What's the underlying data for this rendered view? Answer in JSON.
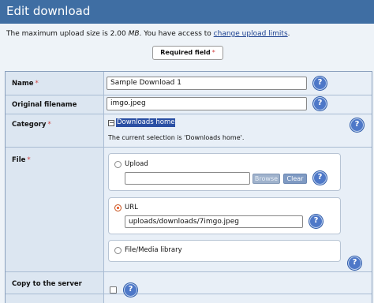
{
  "header": {
    "title": "Edit download"
  },
  "intro": {
    "text_before": "The maximum upload size is 2.00 ",
    "size_unit": "MB",
    "text_middle": ". You have access to ",
    "link": "change upload limits",
    "text_after": "."
  },
  "legend": {
    "required_label": "Required field",
    "marker": "*"
  },
  "fields": {
    "name": {
      "label": "Name",
      "required_marker": "*",
      "value": "Sample Download 1"
    },
    "original_filename": {
      "label": "Original filename",
      "value": "imgo.jpeg"
    },
    "category": {
      "label": "Category",
      "required_marker": "*",
      "tree_toggle": "−",
      "selected": "Downloads home",
      "note": "The current selection is 'Downloads home'."
    },
    "file": {
      "label": "File",
      "required_marker": "*",
      "options": {
        "upload": {
          "label": "Upload",
          "value": "",
          "browse": "Browse",
          "clear": "Clear",
          "checked": false
        },
        "url": {
          "label": "URL",
          "value": "uploads/downloads/7imgo.jpeg",
          "checked": true
        },
        "library": {
          "label": "File/Media library",
          "checked": false
        }
      }
    },
    "copy_to_server": {
      "label": "Copy to the server",
      "checked": false
    }
  },
  "help_glyph": "?",
  "colors": {
    "header": "#3f6ea3",
    "accent": "#2a4fa3",
    "radio_on": "#e8501a",
    "required": "#d04040"
  }
}
